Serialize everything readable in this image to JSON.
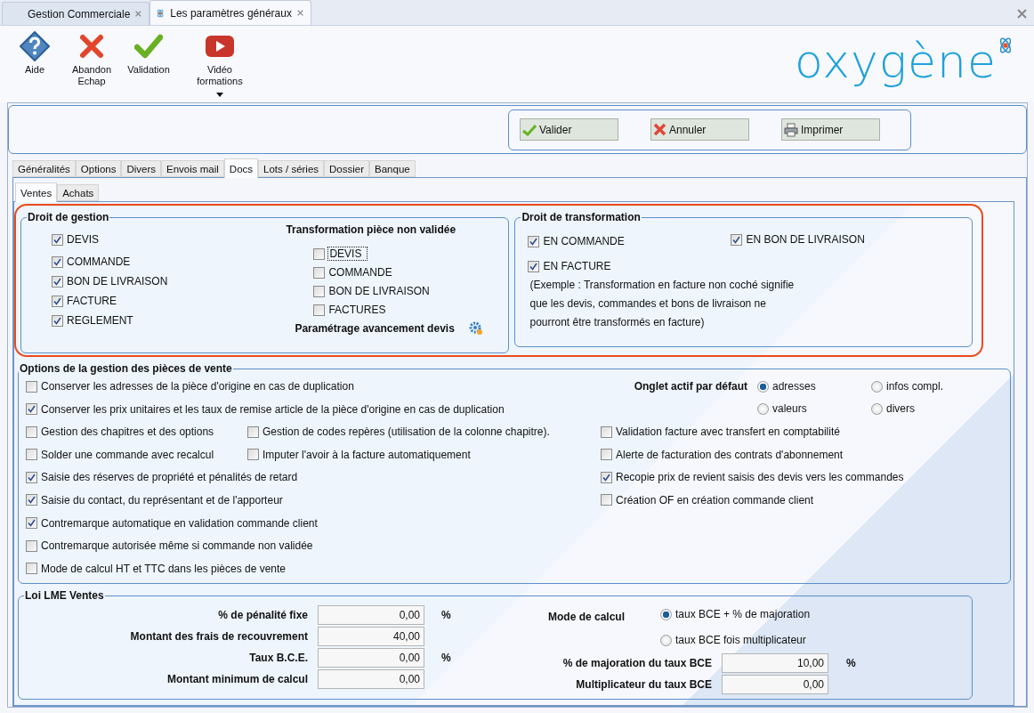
{
  "doc_tabs": [
    {
      "label": "Gestion Commerciale",
      "selected": false
    },
    {
      "label": "Les paramètres généraux",
      "selected": true
    }
  ],
  "toolbar": [
    {
      "kind": "help",
      "lines": [
        "Aide"
      ],
      "dropdown": false
    },
    {
      "kind": "cancel",
      "lines": [
        "Abandon",
        "Echap"
      ],
      "dropdown": false
    },
    {
      "kind": "check",
      "lines": [
        "Validation"
      ],
      "dropdown": false
    },
    {
      "kind": "video",
      "lines": [
        "Vidéo",
        "formations"
      ],
      "dropdown": true
    }
  ],
  "logo": "oxygène",
  "actions": [
    {
      "kind": "check",
      "label": "Valider"
    },
    {
      "kind": "cancel",
      "label": "Annuler"
    },
    {
      "kind": "print",
      "label": "Imprimer"
    }
  ],
  "tabs": [
    {
      "label": "Généralités",
      "selected": false
    },
    {
      "label": "Options",
      "selected": false
    },
    {
      "label": "Divers",
      "selected": false
    },
    {
      "label": "Envois mail",
      "selected": false
    },
    {
      "label": "Docs",
      "selected": true
    },
    {
      "label": "Lots / séries",
      "selected": false
    },
    {
      "label": "Dossier",
      "selected": false
    },
    {
      "label": "Banque",
      "selected": false
    }
  ],
  "subtabs": [
    {
      "label": "Ventes",
      "selected": true
    },
    {
      "label": "Achats",
      "selected": false
    }
  ],
  "droit_gestion": {
    "title": "Droit de gestion",
    "items": [
      {
        "label": "DEVIS",
        "checked": true
      },
      {
        "label": "COMMANDE",
        "checked": true
      },
      {
        "label": "BON DE LIVRAISON",
        "checked": true
      },
      {
        "label": "FACTURE",
        "checked": true
      },
      {
        "label": "REGLEMENT",
        "checked": true
      }
    ],
    "non_validee": {
      "title": "Transformation pièce non validée",
      "items": [
        {
          "label": "DEVIS",
          "checked": false,
          "focused": true
        },
        {
          "label": "COMMANDE",
          "checked": false,
          "focused": false
        },
        {
          "label": "BON DE LIVRAISON",
          "checked": false,
          "focused": false
        },
        {
          "label": "FACTURES",
          "checked": false,
          "focused": false
        }
      ],
      "setting_label": "Paramétrage avancement devis"
    }
  },
  "droit_transformation": {
    "title": "Droit de transformation",
    "items": [
      {
        "label": "EN COMMANDE",
        "checked": true
      },
      {
        "label": "EN BON DE LIVRAISON",
        "checked": true
      },
      {
        "label": "EN FACTURE",
        "checked": true
      }
    ],
    "note_lines": [
      "(Exemple : Transformation en facture non coché signifie",
      "que les devis, commandes et bons de livraison ne",
      "pourront être transformés en facture)"
    ]
  },
  "options": {
    "title": "Options de la gestion des pièces de vente",
    "rows": [
      [
        {
          "label": "Conserver les adresses de la pièce d'origine en cas de duplication",
          "checked": false
        }
      ],
      [
        {
          "label": "Conserver les prix unitaires et les taux de remise article de la pièce d'origine en cas de duplication",
          "checked": true
        }
      ],
      [
        {
          "label": "Gestion des chapitres et des options",
          "checked": false
        },
        {
          "label": "Gestion de codes repères (utilisation de la colonne chapitre).",
          "checked": false
        }
      ],
      [
        {
          "label": "Solder une commande avec recalcul",
          "checked": false
        },
        {
          "label": "Imputer l'avoir à la facture automatiquement",
          "checked": false
        }
      ],
      [
        {
          "label": "Saisie des réserves de propriété et pénalités de retard",
          "checked": true
        }
      ],
      [
        {
          "label": "Saisie du contact, du représentant et de l'apporteur",
          "checked": true
        }
      ],
      [
        {
          "label": "Contremarque automatique en validation commande client",
          "checked": true
        }
      ],
      [
        {
          "label": "Contremarque autorisée même si commande non validée",
          "checked": false
        }
      ],
      [
        {
          "label": "Mode de calcul HT et TTC dans les pièces de vente",
          "checked": false
        }
      ]
    ],
    "default_tab": {
      "label": "Onglet actif par défaut",
      "choices": [
        {
          "label": "adresses",
          "selected": true
        },
        {
          "label": "infos compl.",
          "selected": false
        },
        {
          "label": "valeurs",
          "selected": false
        },
        {
          "label": "divers",
          "selected": false
        }
      ]
    },
    "right_items": [
      {
        "label": "Validation facture avec transfert en comptabilité",
        "checked": false
      },
      {
        "label": "Alerte de facturation des contrats d'abonnement",
        "checked": false
      },
      {
        "label": "Recopie prix de revient saisis des devis vers les commandes",
        "checked": true
      },
      {
        "label": "Création OF en création commande client",
        "checked": false
      }
    ]
  },
  "lme": {
    "title": "Loi LME Ventes",
    "fields": [
      {
        "label": "% de pénalité fixe",
        "value": "0,00",
        "unit": "%"
      },
      {
        "label": "Montant des frais de recouvrement",
        "value": "40,00"
      },
      {
        "label": "Taux B.C.E.",
        "value": "0,00",
        "unit": "%"
      },
      {
        "label": "Montant minimum de calcul",
        "value": "0,00"
      }
    ],
    "mode": {
      "label": "Mode de calcul",
      "choices": [
        {
          "label": "taux BCE + % de majoration",
          "selected": true
        },
        {
          "label": "taux BCE fois multiplicateur",
          "selected": false
        }
      ]
    },
    "right_fields": [
      {
        "label": "% de majoration du taux BCE",
        "value": "10,00",
        "unit": "%"
      },
      {
        "label": "Multiplicateur du taux BCE",
        "value": "0,00"
      }
    ]
  }
}
